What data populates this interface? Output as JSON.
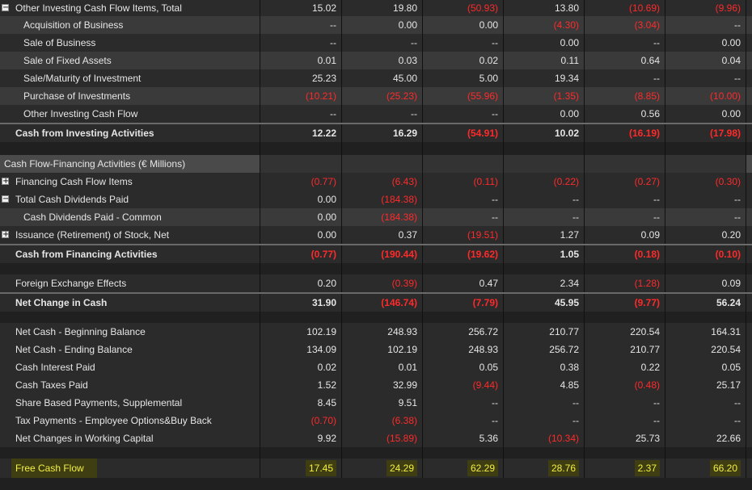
{
  "rows": [
    {
      "h": 20,
      "label": "Other Investing Cash Flow Items, Total",
      "indent": 1,
      "toggle": "minus",
      "bg": "#2b2b2b",
      "values": [
        "15.02",
        "19.80",
        "(50.93)",
        "13.80",
        "(10.69)",
        "(9.96)"
      ]
    },
    {
      "h": 22,
      "label": "Acquisition of Business",
      "indent": 2,
      "bg": "#3a3a3a",
      "values": [
        "--",
        "0.00",
        "0.00",
        "(4.30)",
        "(3.04)",
        "--"
      ]
    },
    {
      "h": 22,
      "label": "Sale of Business",
      "indent": 2,
      "bg": "#2b2b2b",
      "values": [
        "--",
        "--",
        "--",
        "0.00",
        "--",
        "0.00"
      ]
    },
    {
      "h": 22,
      "label": "Sale of Fixed Assets",
      "indent": 2,
      "bg": "#3a3a3a",
      "values": [
        "0.01",
        "0.03",
        "0.02",
        "0.11",
        "0.64",
        "0.04"
      ]
    },
    {
      "h": 22,
      "label": "Sale/Maturity of Investment",
      "indent": 2,
      "bg": "#2b2b2b",
      "values": [
        "25.23",
        "45.00",
        "5.00",
        "19.34",
        "--",
        "--"
      ]
    },
    {
      "h": 22,
      "label": "Purchase of Investments",
      "indent": 2,
      "bg": "#3a3a3a",
      "values": [
        "(10.21)",
        "(25.23)",
        "(55.96)",
        "(1.35)",
        "(8.85)",
        "(10.00)"
      ]
    },
    {
      "h": 22,
      "label": "Other Investing Cash Flow",
      "indent": 2,
      "bg": "#2b2b2b",
      "values": [
        "--",
        "--",
        "--",
        "0.00",
        "0.56",
        "0.00"
      ]
    },
    {
      "h": 24,
      "label": "Cash from Investing Activities",
      "indent": 1,
      "bold": true,
      "bg": "#2b2b2b",
      "topline": true,
      "values": [
        "12.22",
        "16.29",
        "(54.91)",
        "10.02",
        "(16.19)",
        "(17.98)"
      ]
    },
    {
      "h": 16,
      "label": "",
      "indent": 0,
      "bg": "#202020",
      "values": [
        "",
        "",
        "",
        "",
        "",
        ""
      ]
    },
    {
      "h": 22,
      "label": "Cash Flow-Financing Activities (€ Millions)",
      "indent": 0,
      "section": true,
      "bg": "#4a4a4a",
      "values": [
        "",
        "",
        "",
        "",
        "",
        ""
      ]
    },
    {
      "h": 22,
      "label": "Financing Cash Flow Items",
      "indent": 1,
      "toggle": "plus",
      "bg": "#2b2b2b",
      "values": [
        "(0.77)",
        "(6.43)",
        "(0.11)",
        "(0.22)",
        "(0.27)",
        "(0.30)"
      ]
    },
    {
      "h": 22,
      "label": "Total Cash Dividends Paid",
      "indent": 1,
      "toggle": "minus",
      "bg": "#2b2b2b",
      "values": [
        "0.00",
        "(184.38)",
        "--",
        "--",
        "--",
        "--"
      ]
    },
    {
      "h": 22,
      "label": "Cash Dividends Paid - Common",
      "indent": 2,
      "bg": "#3a3a3a",
      "values": [
        "0.00",
        "(184.38)",
        "--",
        "--",
        "--",
        "--"
      ]
    },
    {
      "h": 22,
      "label": "Issuance (Retirement) of Stock, Net",
      "indent": 1,
      "toggle": "plus",
      "bg": "#2b2b2b",
      "values": [
        "0.00",
        "0.37",
        "(19.51)",
        "1.27",
        "0.09",
        "0.20"
      ]
    },
    {
      "h": 24,
      "label": "Cash from Financing Activities",
      "indent": 1,
      "bold": true,
      "bg": "#2b2b2b",
      "topline": true,
      "values": [
        "(0.77)",
        "(190.44)",
        "(19.62)",
        "1.05",
        "(0.18)",
        "(0.10)"
      ]
    },
    {
      "h": 14,
      "label": "",
      "indent": 0,
      "bg": "#202020",
      "values": [
        "",
        "",
        "",
        "",
        "",
        ""
      ]
    },
    {
      "h": 22,
      "label": "Foreign Exchange Effects",
      "indent": 1,
      "bg": "#2b2b2b",
      "values": [
        "0.20",
        "(0.39)",
        "0.47",
        "2.34",
        "(1.28)",
        "0.09"
      ]
    },
    {
      "h": 24,
      "label": "Net Change in Cash",
      "indent": 1,
      "bold": true,
      "bg": "#2b2b2b",
      "topline": true,
      "values": [
        "31.90",
        "(146.74)",
        "(7.79)",
        "45.95",
        "(9.77)",
        "56.24"
      ]
    },
    {
      "h": 14,
      "label": "",
      "indent": 0,
      "bg": "#202020",
      "values": [
        "",
        "",
        "",
        "",
        "",
        ""
      ]
    },
    {
      "h": 22,
      "label": "Net Cash - Beginning Balance",
      "indent": 1,
      "bg": "#2b2b2b",
      "values": [
        "102.19",
        "248.93",
        "256.72",
        "210.77",
        "220.54",
        "164.31"
      ]
    },
    {
      "h": 22,
      "label": "Net Cash - Ending Balance",
      "indent": 1,
      "bg": "#2b2b2b",
      "values": [
        "134.09",
        "102.19",
        "248.93",
        "256.72",
        "210.77",
        "220.54"
      ]
    },
    {
      "h": 22,
      "label": "Cash Interest Paid",
      "indent": 1,
      "bg": "#2b2b2b",
      "values": [
        "0.02",
        "0.01",
        "0.05",
        "0.38",
        "0.22",
        "0.05"
      ]
    },
    {
      "h": 22,
      "label": "Cash Taxes Paid",
      "indent": 1,
      "bg": "#2b2b2b",
      "values": [
        "1.52",
        "32.99",
        "(9.44)",
        "4.85",
        "(0.48)",
        "25.17"
      ]
    },
    {
      "h": 22,
      "label": "Share Based Payments, Supplemental",
      "indent": 1,
      "bg": "#2b2b2b",
      "values": [
        "8.45",
        "9.51",
        "--",
        "--",
        "--",
        "--"
      ]
    },
    {
      "h": 22,
      "label": "Tax Payments - Employee Options&Buy Back",
      "indent": 1,
      "bg": "#2b2b2b",
      "values": [
        "(0.70)",
        "(6.38)",
        "--",
        "--",
        "--",
        "--"
      ]
    },
    {
      "h": 22,
      "label": "Net Changes in Working Capital",
      "indent": 1,
      "bg": "#2b2b2b",
      "values": [
        "9.92",
        "(15.89)",
        "5.36",
        "(10.34)",
        "25.73",
        "22.66"
      ]
    },
    {
      "h": 14,
      "label": "",
      "indent": 0,
      "bg": "#202020",
      "values": [
        "",
        "",
        "",
        "",
        "",
        ""
      ]
    },
    {
      "h": 24,
      "label": "Free Cash Flow",
      "indent": 1,
      "highlight": true,
      "bg": "#2b2b2b",
      "values": [
        "17.45",
        "24.29",
        "62.29",
        "28.76",
        "2.37",
        "66.20"
      ]
    }
  ]
}
